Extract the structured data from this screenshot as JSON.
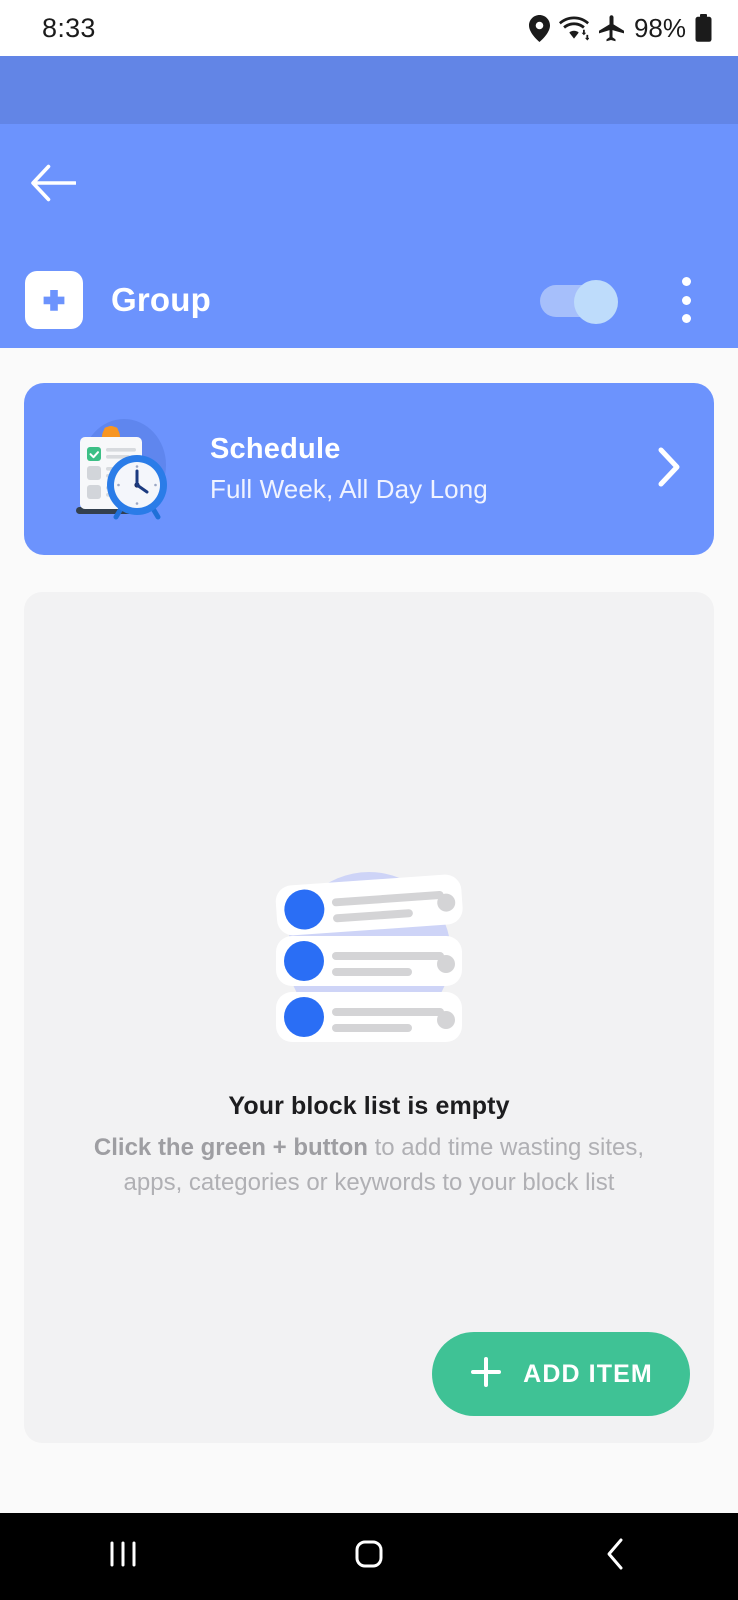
{
  "status_bar": {
    "time": "8:33",
    "battery_percent": "98%",
    "icons": [
      "location-pin-icon",
      "wifi-icon",
      "airplane-mode-icon",
      "battery-icon"
    ]
  },
  "header": {
    "back_icon": "back-arrow-icon",
    "group_icon": "plus-square-icon",
    "title": "Group",
    "toggle": {
      "state": "on",
      "label": "group-enabled-toggle"
    },
    "overflow_icon": "more-vertical-icon"
  },
  "schedule_card": {
    "illustration": "clipboard-clock-icon",
    "title": "Schedule",
    "subtitle": "Full Week, All Day Long",
    "chevron_icon": "chevron-right-icon"
  },
  "empty_state": {
    "illustration": "empty-list-icon",
    "title": "Your block list is empty",
    "description_bold": "Click the green + button",
    "description_rest": " to add time wasting sites, apps, categories or keywords to your block list"
  },
  "fab": {
    "icon": "plus-icon",
    "label": "ADD ITEM"
  },
  "nav_bar": {
    "recents_icon": "recents-icon",
    "home_icon": "home-icon",
    "back_icon": "nav-back-icon"
  },
  "colors": {
    "header_top": "#6285e6",
    "appbar": "#6c93fd",
    "card_blue": "#6c93fd",
    "accent_green": "#3fc295",
    "page_bg": "#fafafa",
    "content_bg": "#f2f2f3"
  }
}
